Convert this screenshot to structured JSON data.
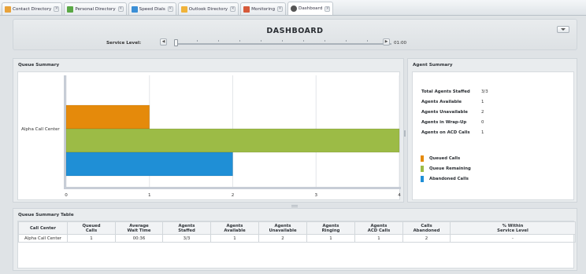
{
  "tabs": [
    {
      "label": "Contact Directory",
      "icon": "contacts-icon",
      "color": "#e8a23a"
    },
    {
      "label": "Personal Directory",
      "icon": "personal-directory-icon",
      "color": "#5aa845"
    },
    {
      "label": "Speed Dials",
      "icon": "speed-dials-icon",
      "color": "#3b8fd6"
    },
    {
      "label": "Outlook Directory",
      "icon": "outlook-directory-icon",
      "color": "#f0b33a"
    },
    {
      "label": "Monitoring",
      "icon": "monitoring-icon",
      "color": "#d65a3b"
    },
    {
      "label": "Dashboard",
      "icon": "dashboard-icon",
      "color": "#555555"
    }
  ],
  "header": {
    "title": "DASHBOARD",
    "service_level_label": "Service Level:",
    "service_level_value": "01:00"
  },
  "queue_summary": {
    "title": "Queue Summary",
    "category_label": "Alpha Call Center"
  },
  "chart_data": {
    "type": "bar",
    "orientation": "horizontal",
    "categories": [
      "Alpha Call Center"
    ],
    "series": [
      {
        "name": "Queued Calls",
        "values": [
          1
        ],
        "color": "#e58a0b"
      },
      {
        "name": "Queue Remaining",
        "values": [
          4
        ],
        "color": "#9cbb46"
      },
      {
        "name": "Abandoned Calls",
        "values": [
          2
        ],
        "color": "#1f8fd6"
      }
    ],
    "xlim": [
      0,
      4
    ],
    "xticks": [
      "0",
      "1",
      "2",
      "3",
      "4"
    ],
    "grid": true,
    "legend": "right-panel"
  },
  "agent_summary": {
    "title": "Agent Summary",
    "stats": [
      {
        "label": "Total Agents Staffed",
        "value": "3/3"
      },
      {
        "label": "Agents Available",
        "value": "1"
      },
      {
        "label": "Agents Unavailable",
        "value": "2"
      },
      {
        "label": "Agents in Wrap-Up",
        "value": "0"
      },
      {
        "label": "Agents on ACD Calls",
        "value": "1"
      }
    ],
    "legend": [
      {
        "label": "Queued Calls",
        "color": "#e58a0b"
      },
      {
        "label": "Queue Remaining",
        "color": "#9cbb46"
      },
      {
        "label": "Abandoned Calls",
        "color": "#1f8fd6"
      }
    ]
  },
  "table": {
    "title": "Queue Summary Table",
    "headers": [
      [
        "Call Center"
      ],
      [
        "Queued",
        "Calls"
      ],
      [
        "Average",
        "Wait Time"
      ],
      [
        "Agents",
        "Staffed"
      ],
      [
        "Agents",
        "Available"
      ],
      [
        "Agents",
        "Unavailable"
      ],
      [
        "Agents",
        "Ringing"
      ],
      [
        "Agents",
        "ACD Calls"
      ],
      [
        "Calls",
        "Abandoned"
      ],
      [
        "% Within",
        "Service Level"
      ]
    ],
    "rows": [
      [
        "Alpha Call Center",
        "1",
        "00:36",
        "3/3",
        "1",
        "2",
        "1",
        "1",
        "2",
        "-"
      ]
    ]
  }
}
